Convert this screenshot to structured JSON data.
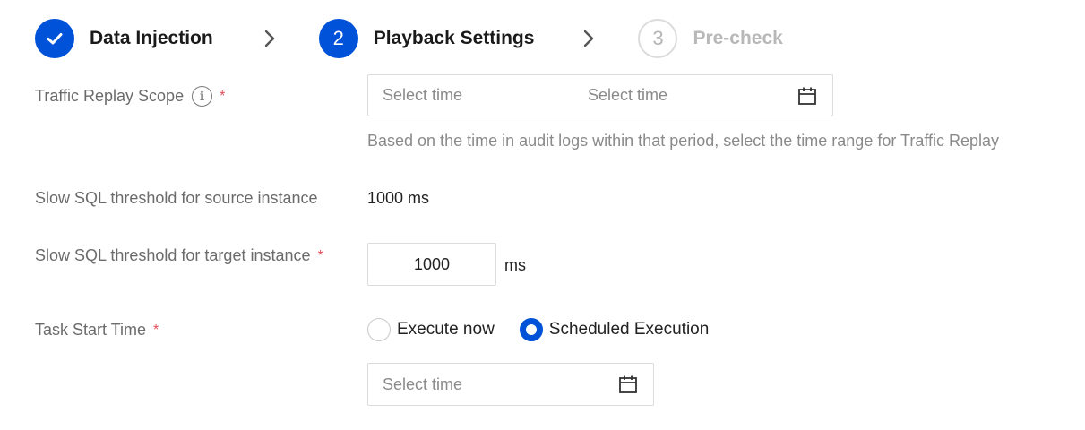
{
  "stepper": {
    "steps": [
      {
        "label": "Data Injection",
        "number": "",
        "status": "done"
      },
      {
        "label": "Playback Settings",
        "number": "2",
        "status": "active"
      },
      {
        "label": "Pre-check",
        "number": "3",
        "status": "todo"
      }
    ]
  },
  "form": {
    "replay_scope": {
      "label": "Traffic Replay Scope",
      "required_mark": "*",
      "start_placeholder": "Select time",
      "end_placeholder": "Select time",
      "hint": "Based on the time in audit logs within that period, select the time range for Traffic Replay"
    },
    "source_threshold": {
      "label": "Slow SQL threshold for source instance",
      "value": "1000 ms"
    },
    "target_threshold": {
      "label": "Slow SQL threshold for target instance",
      "required_mark": "*",
      "value": "1000",
      "unit": "ms"
    },
    "task_start": {
      "label": "Task Start Time",
      "required_mark": "*",
      "options": [
        {
          "label": "Execute now",
          "checked": false
        },
        {
          "label": "Scheduled Execution",
          "checked": true
        }
      ],
      "time_placeholder": "Select time"
    }
  },
  "colors": {
    "primary": "#0052d9",
    "required": "#e34d59",
    "border": "#dcdcdc",
    "muted_text": "#8a8a8a"
  },
  "icons": {
    "done": "check-icon",
    "separator": "chevron-right-icon",
    "info": "info-icon",
    "calendar": "calendar-icon"
  }
}
